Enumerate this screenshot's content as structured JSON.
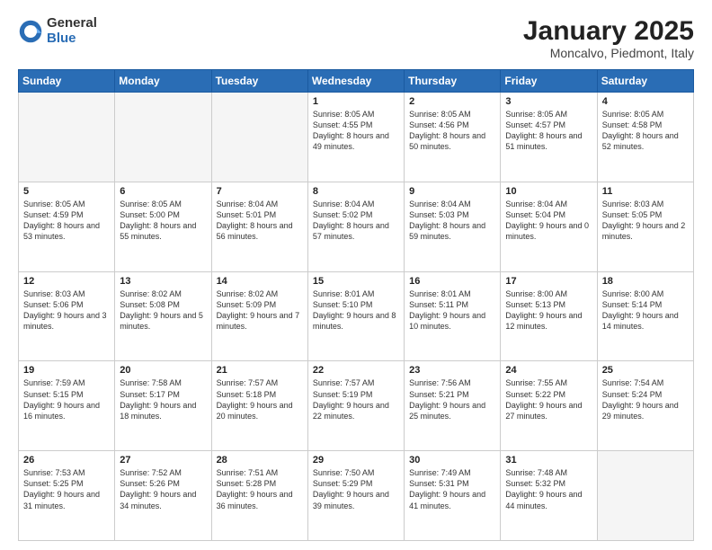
{
  "header": {
    "logo_general": "General",
    "logo_blue": "Blue",
    "month_title": "January 2025",
    "location": "Moncalvo, Piedmont, Italy"
  },
  "weekdays": [
    "Sunday",
    "Monday",
    "Tuesday",
    "Wednesday",
    "Thursday",
    "Friday",
    "Saturday"
  ],
  "weeks": [
    [
      {
        "day": "",
        "info": ""
      },
      {
        "day": "",
        "info": ""
      },
      {
        "day": "",
        "info": ""
      },
      {
        "day": "1",
        "info": "Sunrise: 8:05 AM\nSunset: 4:55 PM\nDaylight: 8 hours\nand 49 minutes."
      },
      {
        "day": "2",
        "info": "Sunrise: 8:05 AM\nSunset: 4:56 PM\nDaylight: 8 hours\nand 50 minutes."
      },
      {
        "day": "3",
        "info": "Sunrise: 8:05 AM\nSunset: 4:57 PM\nDaylight: 8 hours\nand 51 minutes."
      },
      {
        "day": "4",
        "info": "Sunrise: 8:05 AM\nSunset: 4:58 PM\nDaylight: 8 hours\nand 52 minutes."
      }
    ],
    [
      {
        "day": "5",
        "info": "Sunrise: 8:05 AM\nSunset: 4:59 PM\nDaylight: 8 hours\nand 53 minutes."
      },
      {
        "day": "6",
        "info": "Sunrise: 8:05 AM\nSunset: 5:00 PM\nDaylight: 8 hours\nand 55 minutes."
      },
      {
        "day": "7",
        "info": "Sunrise: 8:04 AM\nSunset: 5:01 PM\nDaylight: 8 hours\nand 56 minutes."
      },
      {
        "day": "8",
        "info": "Sunrise: 8:04 AM\nSunset: 5:02 PM\nDaylight: 8 hours\nand 57 minutes."
      },
      {
        "day": "9",
        "info": "Sunrise: 8:04 AM\nSunset: 5:03 PM\nDaylight: 8 hours\nand 59 minutes."
      },
      {
        "day": "10",
        "info": "Sunrise: 8:04 AM\nSunset: 5:04 PM\nDaylight: 9 hours\nand 0 minutes."
      },
      {
        "day": "11",
        "info": "Sunrise: 8:03 AM\nSunset: 5:05 PM\nDaylight: 9 hours\nand 2 minutes."
      }
    ],
    [
      {
        "day": "12",
        "info": "Sunrise: 8:03 AM\nSunset: 5:06 PM\nDaylight: 9 hours\nand 3 minutes."
      },
      {
        "day": "13",
        "info": "Sunrise: 8:02 AM\nSunset: 5:08 PM\nDaylight: 9 hours\nand 5 minutes."
      },
      {
        "day": "14",
        "info": "Sunrise: 8:02 AM\nSunset: 5:09 PM\nDaylight: 9 hours\nand 7 minutes."
      },
      {
        "day": "15",
        "info": "Sunrise: 8:01 AM\nSunset: 5:10 PM\nDaylight: 9 hours\nand 8 minutes."
      },
      {
        "day": "16",
        "info": "Sunrise: 8:01 AM\nSunset: 5:11 PM\nDaylight: 9 hours\nand 10 minutes."
      },
      {
        "day": "17",
        "info": "Sunrise: 8:00 AM\nSunset: 5:13 PM\nDaylight: 9 hours\nand 12 minutes."
      },
      {
        "day": "18",
        "info": "Sunrise: 8:00 AM\nSunset: 5:14 PM\nDaylight: 9 hours\nand 14 minutes."
      }
    ],
    [
      {
        "day": "19",
        "info": "Sunrise: 7:59 AM\nSunset: 5:15 PM\nDaylight: 9 hours\nand 16 minutes."
      },
      {
        "day": "20",
        "info": "Sunrise: 7:58 AM\nSunset: 5:17 PM\nDaylight: 9 hours\nand 18 minutes."
      },
      {
        "day": "21",
        "info": "Sunrise: 7:57 AM\nSunset: 5:18 PM\nDaylight: 9 hours\nand 20 minutes."
      },
      {
        "day": "22",
        "info": "Sunrise: 7:57 AM\nSunset: 5:19 PM\nDaylight: 9 hours\nand 22 minutes."
      },
      {
        "day": "23",
        "info": "Sunrise: 7:56 AM\nSunset: 5:21 PM\nDaylight: 9 hours\nand 25 minutes."
      },
      {
        "day": "24",
        "info": "Sunrise: 7:55 AM\nSunset: 5:22 PM\nDaylight: 9 hours\nand 27 minutes."
      },
      {
        "day": "25",
        "info": "Sunrise: 7:54 AM\nSunset: 5:24 PM\nDaylight: 9 hours\nand 29 minutes."
      }
    ],
    [
      {
        "day": "26",
        "info": "Sunrise: 7:53 AM\nSunset: 5:25 PM\nDaylight: 9 hours\nand 31 minutes."
      },
      {
        "day": "27",
        "info": "Sunrise: 7:52 AM\nSunset: 5:26 PM\nDaylight: 9 hours\nand 34 minutes."
      },
      {
        "day": "28",
        "info": "Sunrise: 7:51 AM\nSunset: 5:28 PM\nDaylight: 9 hours\nand 36 minutes."
      },
      {
        "day": "29",
        "info": "Sunrise: 7:50 AM\nSunset: 5:29 PM\nDaylight: 9 hours\nand 39 minutes."
      },
      {
        "day": "30",
        "info": "Sunrise: 7:49 AM\nSunset: 5:31 PM\nDaylight: 9 hours\nand 41 minutes."
      },
      {
        "day": "31",
        "info": "Sunrise: 7:48 AM\nSunset: 5:32 PM\nDaylight: 9 hours\nand 44 minutes."
      },
      {
        "day": "",
        "info": ""
      }
    ]
  ]
}
